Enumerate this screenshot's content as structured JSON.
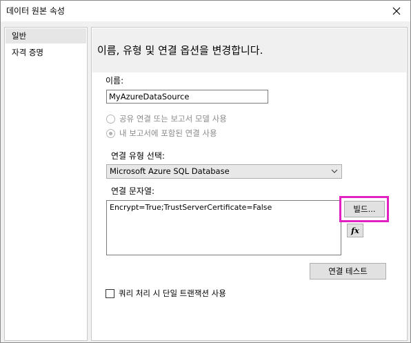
{
  "window": {
    "title": "데이터 원본 속성",
    "close_icon": "close-icon"
  },
  "sidebar": {
    "items": [
      {
        "label": "일반",
        "selected": true
      },
      {
        "label": "자격 증명",
        "selected": false
      }
    ]
  },
  "main": {
    "heading": "이름, 유형 및 연결 옵션을 변경합니다.",
    "name_label": "이름:",
    "name_value": "MyAzureDataSource",
    "radio_shared_label": "공유 연결 또는 보고서 모델 사용",
    "radio_embedded_label": "내 보고서에 포함된 연결 사용",
    "radio_selected": "embedded",
    "connection_type_label": "연결 유형 선택:",
    "connection_type_value": "Microsoft Azure SQL Database",
    "connection_string_label": "연결 문자열:",
    "connection_string_value": "Encrypt=True;TrustServerCertificate=False",
    "build_button_label": "빌드...",
    "expression_button_label": "fx",
    "test_connection_label": "연결 테스트",
    "single_transaction_label": "쿼리 처리 시 단일 트랜잭션 사용",
    "single_transaction_checked": false
  },
  "colors": {
    "highlight_border": "#e020c0"
  }
}
